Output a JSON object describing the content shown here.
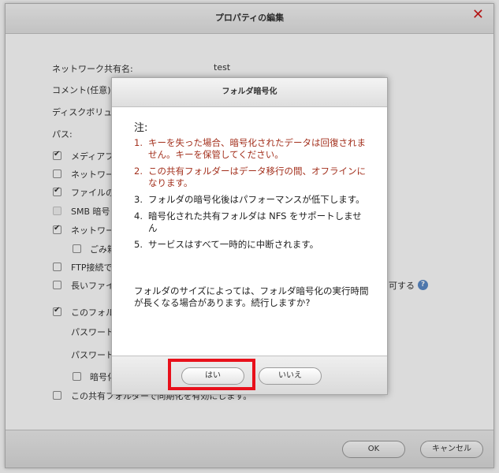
{
  "outer": {
    "title": "プロパティの編集",
    "close_glyph": "✕",
    "ok_label": "OK",
    "cancel_label": "キャンセル",
    "form": {
      "share_name_label": "ネットワーク共有名:",
      "share_name_value": "test",
      "comment_label": "コメント(任意):",
      "disk_volume_label": "ディスクボリュー",
      "path_label": "パス:",
      "opt_media": "メディアフォ",
      "opt_network1": "ネットワー",
      "opt_file": "ファイルの",
      "opt_smb": "SMB 暗号",
      "opt_network2": "ネットワー",
      "opt_trash": "ごみ箱",
      "opt_ftp": "FTP接続で",
      "opt_long_file": "長いファイ",
      "opt_long_file_tail": "可する",
      "opt_folder": "このフォル",
      "password_label1": "パスワード",
      "password_label2": "パスワード",
      "opt_save_key": "暗号化",
      "opt_sync": "この共有フォルダーで同期化を有効にします。",
      "help_glyph": "?"
    }
  },
  "dialog": {
    "title": "フォルダ暗号化",
    "note_heading": "注:",
    "notes": [
      {
        "num": "1.",
        "text": "キーを失った場合、暗号化されたデータは回復されません。キーを保管してください。"
      },
      {
        "num": "2.",
        "text": "この共有フォルダーはデータ移行の間、オフラインになります。"
      },
      {
        "num": "3.",
        "text": "フォルダの暗号化後はパフォーマンスが低下します。"
      },
      {
        "num": "4.",
        "text": "暗号化された共有フォルダは NFS をサポートしません"
      },
      {
        "num": "5.",
        "text": "サービスはすべて一時的に中断されます。"
      }
    ],
    "message": "フォルダのサイズによっては、フォルダ暗号化の実行時間が長くなる場合があります。続行しますか?",
    "yes_label": "はい",
    "no_label": "いいえ"
  },
  "colors": {
    "warning_text": "#a3301d",
    "highlight": "#e8101b",
    "close": "#d11a1a",
    "help_icon": "#5b8bc9"
  }
}
